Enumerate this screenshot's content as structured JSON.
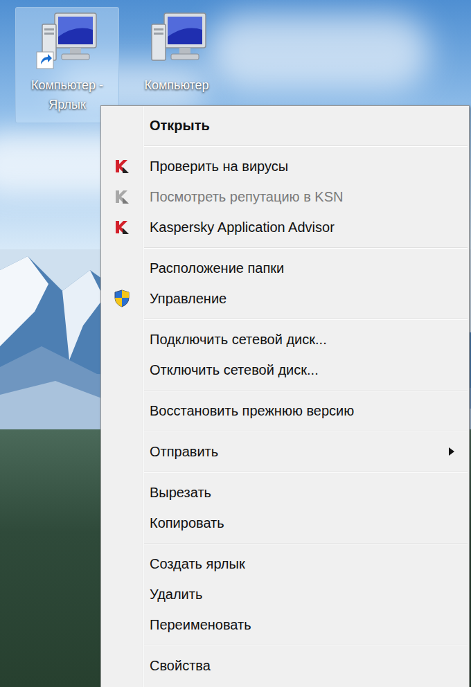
{
  "desktop": {
    "icons": [
      {
        "label": "Компьютер - Ярлык",
        "shortcut": true,
        "selected": true
      },
      {
        "label": "Компьютер",
        "shortcut": false,
        "selected": false
      }
    ]
  },
  "context_menu": {
    "items": [
      {
        "kind": "default",
        "label": "Открыть",
        "bold": true,
        "disabled": false,
        "submenu": false
      },
      {
        "kind": "separator"
      },
      {
        "kind": "antivirus",
        "label": "Проверить на вирусы",
        "bold": false,
        "disabled": false,
        "submenu": false
      },
      {
        "kind": "antivirus",
        "label": "Посмотреть репутацию в KSN",
        "bold": false,
        "disabled": true,
        "submenu": false
      },
      {
        "kind": "antivirus",
        "label": "Kaspersky Application Advisor",
        "bold": false,
        "disabled": false,
        "submenu": false
      },
      {
        "kind": "separator"
      },
      {
        "kind": "default",
        "label": "Расположениe папки",
        "bold": false,
        "disabled": false,
        "submenu": false
      },
      {
        "kind": "admin",
        "label": "Управление",
        "bold": false,
        "disabled": false,
        "submenu": false
      },
      {
        "kind": "separator"
      },
      {
        "kind": "default",
        "label": "Подключить сетевой диск...",
        "bold": false,
        "disabled": false,
        "submenu": false
      },
      {
        "kind": "default",
        "label": "Отключить сетевой диск...",
        "bold": false,
        "disabled": false,
        "submenu": false
      },
      {
        "kind": "separator"
      },
      {
        "kind": "default",
        "label": "Восстановить прежнюю версию",
        "bold": false,
        "disabled": false,
        "submenu": false
      },
      {
        "kind": "separator"
      },
      {
        "kind": "default",
        "label": "Отправить",
        "bold": false,
        "disabled": false,
        "submenu": true
      },
      {
        "kind": "separator"
      },
      {
        "kind": "default",
        "label": "Вырезать",
        "bold": false,
        "disabled": false,
        "submenu": false
      },
      {
        "kind": "default",
        "label": "Копировать",
        "bold": false,
        "disabled": false,
        "submenu": false
      },
      {
        "kind": "separator"
      },
      {
        "kind": "default",
        "label": "Создать ярлык",
        "bold": false,
        "disabled": false,
        "submenu": false
      },
      {
        "kind": "default",
        "label": "Удалить",
        "bold": false,
        "disabled": false,
        "submenu": false
      },
      {
        "kind": "default",
        "label": "Переименовать",
        "bold": false,
        "disabled": false,
        "submenu": false
      },
      {
        "kind": "separator"
      },
      {
        "kind": "default",
        "label": "Свойства",
        "bold": false,
        "disabled": false,
        "submenu": false
      }
    ]
  }
}
